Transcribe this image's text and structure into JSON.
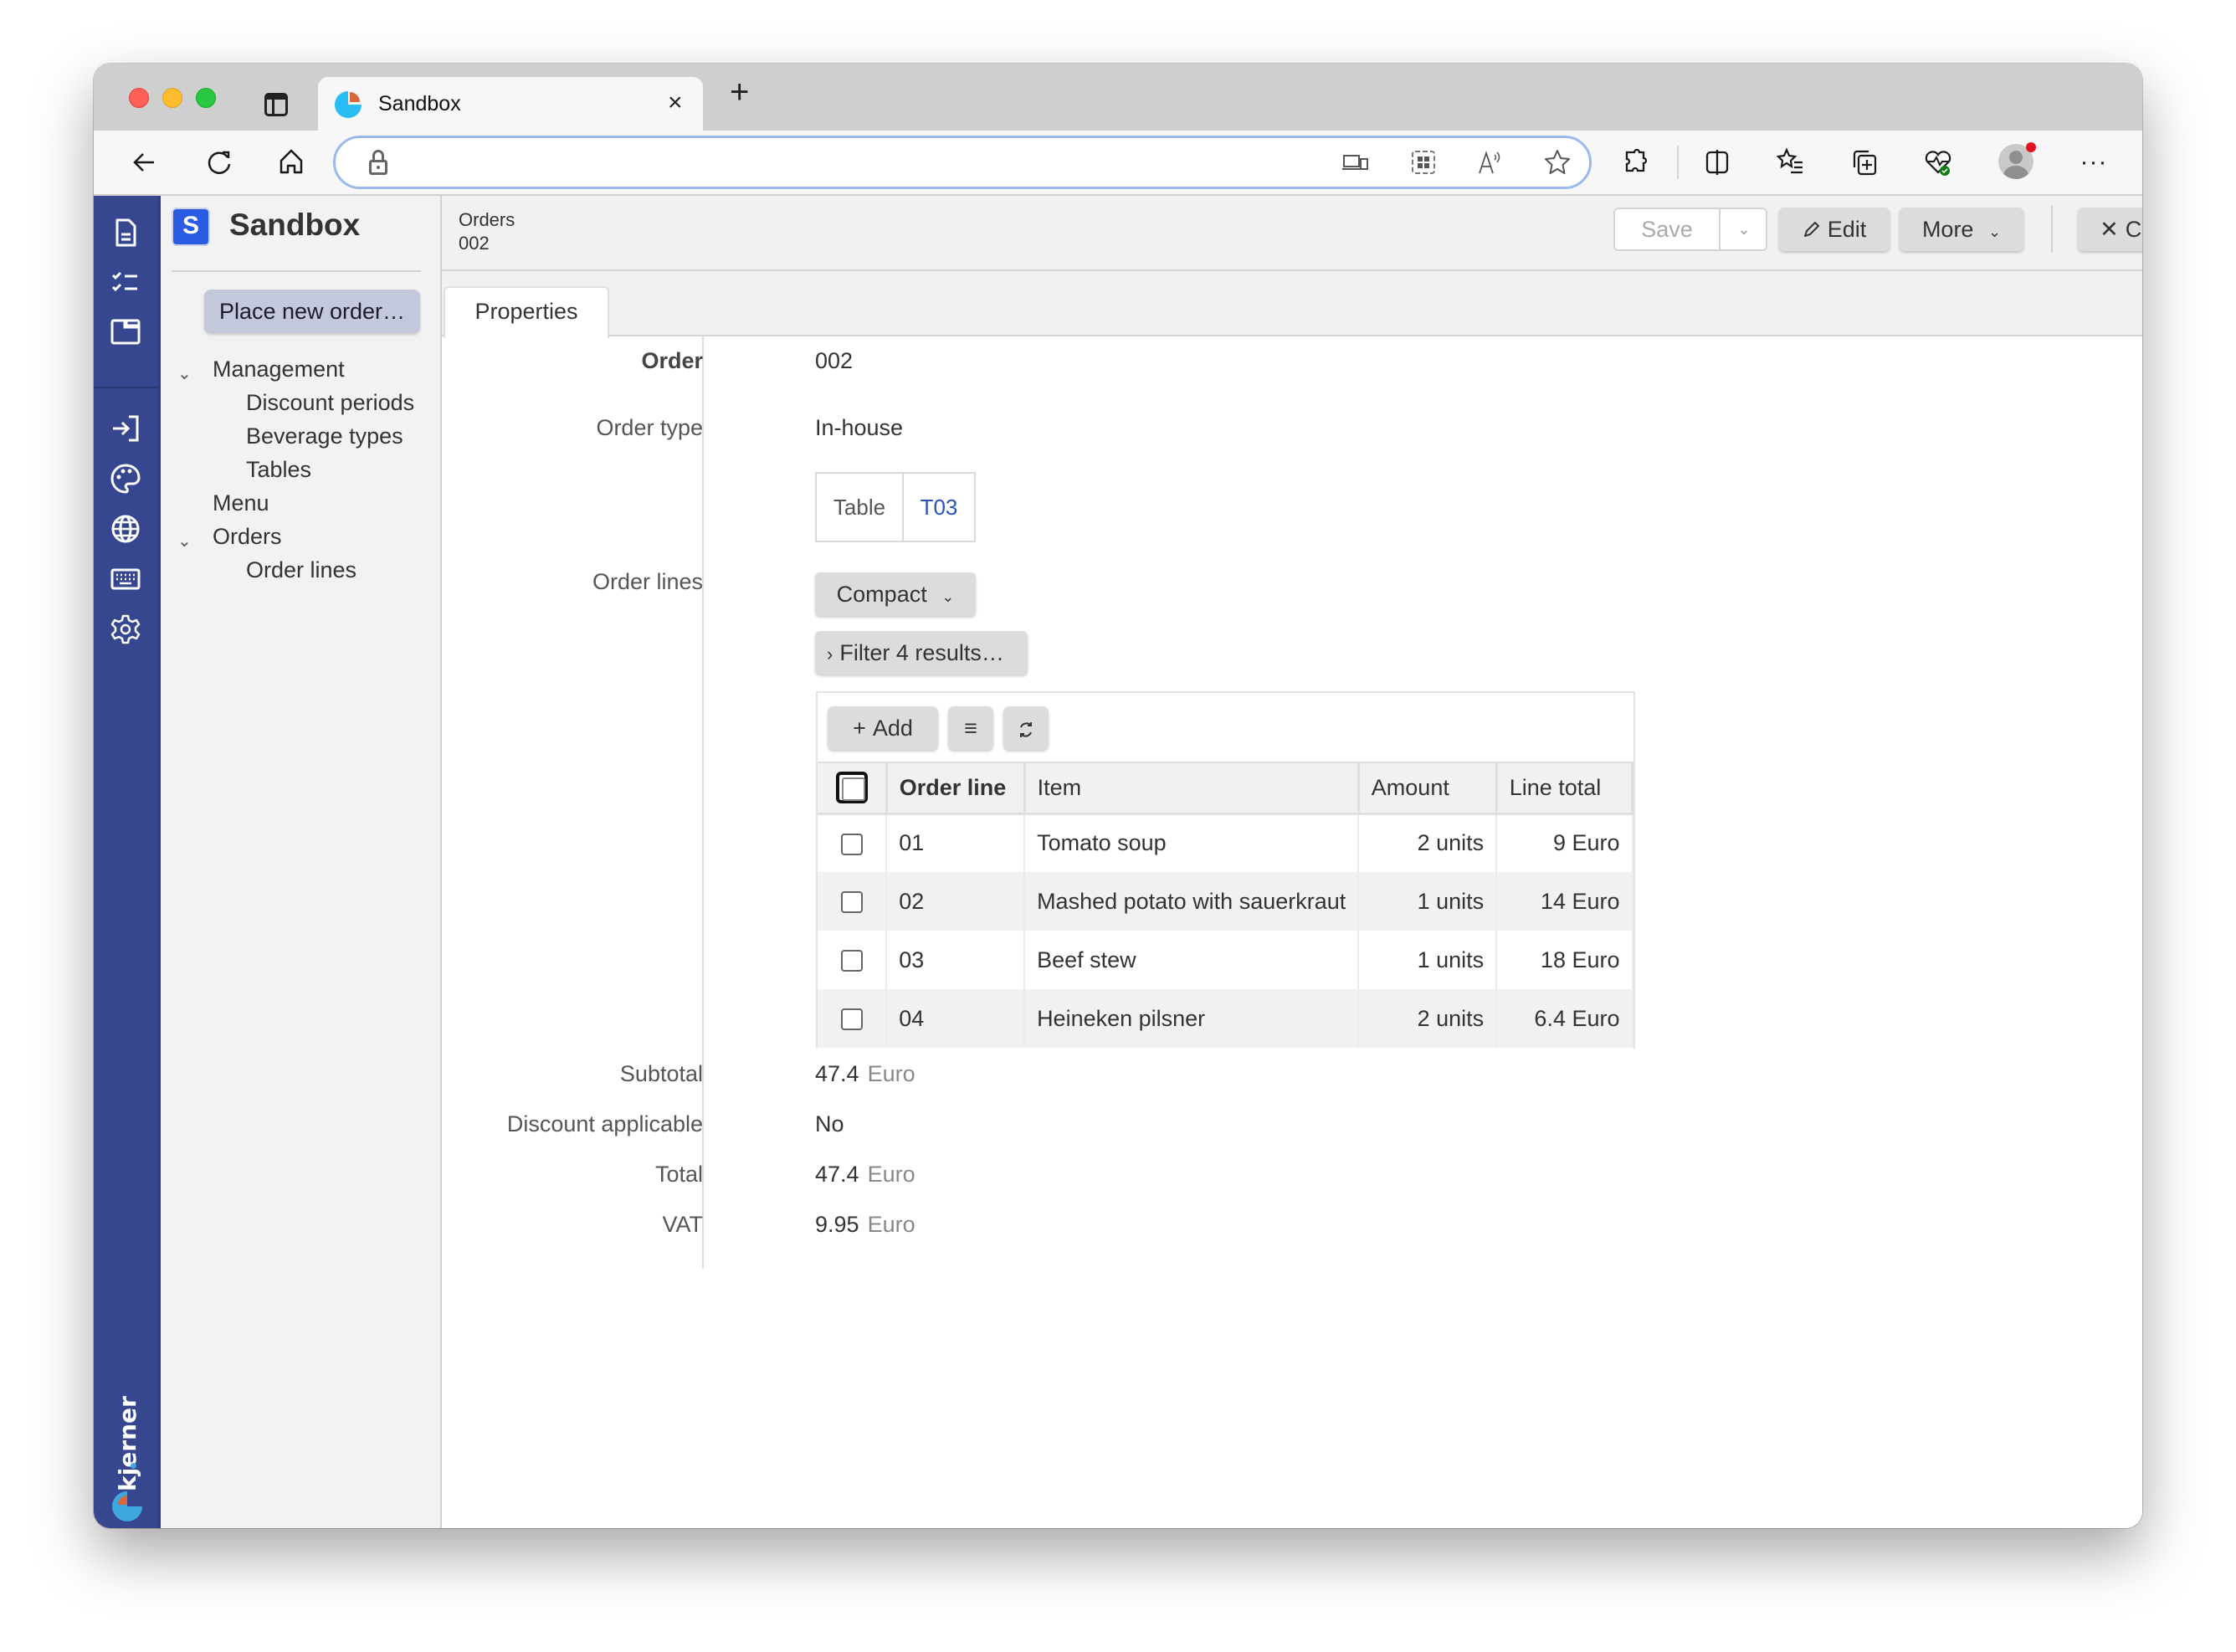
{
  "browser": {
    "tab_title": "Sandbox",
    "tab_close": "×",
    "new_tab": "+",
    "address": "",
    "toolbar_icons": [
      "back-icon",
      "reload-icon",
      "home-icon",
      "lock-icon",
      "device-icon",
      "apps-icon",
      "read-aloud-icon",
      "favorite-star-icon",
      "extensions-icon",
      "split-screen-icon",
      "favorites-list-icon",
      "collections-icon",
      "browser-essentials-icon",
      "profile-avatar",
      "more-icon"
    ]
  },
  "rail": {
    "icons": [
      "document-icon",
      "checklist-icon",
      "window-icon",
      "sign-in-icon",
      "palette-icon",
      "globe-icon",
      "keyboard-icon",
      "settings-icon"
    ],
    "brand": "kjerner"
  },
  "sidebar": {
    "logo_letter": "S",
    "app_title": "Sandbox",
    "primary_action": "Place new order…",
    "nav": [
      {
        "label": "Management",
        "expanded": true,
        "level": 0,
        "children": [
          "Discount periods",
          "Beverage types",
          "Tables"
        ]
      },
      {
        "label": "Menu",
        "level": 0
      },
      {
        "label": "Orders",
        "expanded": true,
        "level": 0,
        "children": [
          "Order lines"
        ]
      }
    ],
    "nav_labels": {
      "management": "Management",
      "discount_periods": "Discount periods",
      "beverage_types": "Beverage types",
      "tables": "Tables",
      "menu": "Menu",
      "orders": "Orders",
      "order_lines": "Order lines"
    }
  },
  "header": {
    "breadcrumb_parent": "Orders",
    "breadcrumb_current": "002",
    "save_label": "Save",
    "edit_label": "Edit",
    "more_label": "More",
    "close_label": "Close"
  },
  "tabs": [
    {
      "label": "Properties",
      "active": true
    }
  ],
  "form": {
    "order_label": "Order",
    "order_value": "002",
    "order_type_label": "Order type",
    "order_type_value": "In-house",
    "table_ref_label": "Table",
    "table_ref_value": "T03",
    "order_lines_label": "Order lines",
    "view_mode": "Compact",
    "filter_label": "Filter 4 results…",
    "subtotal_label": "Subtotal",
    "subtotal_value": "47.4",
    "subtotal_unit": "Euro",
    "discount_label": "Discount applicable",
    "discount_value": "No",
    "total_label": "Total",
    "total_value": "47.4",
    "total_unit": "Euro",
    "vat_label": "VAT",
    "vat_value": "9.95",
    "vat_unit": "Euro"
  },
  "grid": {
    "add_label": "Add",
    "columns": [
      "Order line",
      "Item",
      "Amount",
      "Line total"
    ],
    "rows": [
      {
        "line": "01",
        "item": "Tomato soup",
        "amount": "2 units",
        "total": "9 Euro"
      },
      {
        "line": "02",
        "item": "Mashed potato with sauerkraut",
        "amount": "1 units",
        "total": "14 Euro"
      },
      {
        "line": "03",
        "item": "Beef stew",
        "amount": "1 units",
        "total": "18 Euro"
      },
      {
        "line": "04",
        "item": "Heineken pilsner",
        "amount": "2 units",
        "total": "6.4 Euro"
      }
    ]
  },
  "colors": {
    "rail": "#36478f",
    "logo_badge": "#2a5be3",
    "link": "#2a52be",
    "primary_action_bg": "#c3c8dd",
    "address_focus": "#9ab9ec"
  }
}
